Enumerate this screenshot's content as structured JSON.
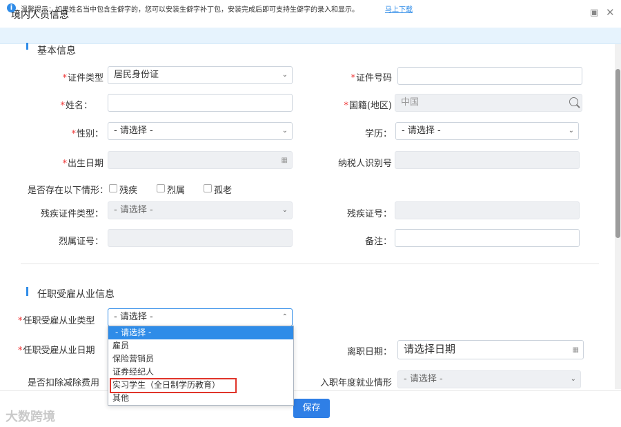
{
  "window": {
    "title": "境内人员信息"
  },
  "notice": {
    "text": "温馨提示：如果姓名当中包含生僻字的，您可以安装生僻字补丁包，安装完成后即可支持生僻字的录入和显示。",
    "link": "马上下载"
  },
  "basic": {
    "section_title": "基本信息",
    "id_type": {
      "label": "证件类型",
      "value": "居民身份证"
    },
    "id_number": {
      "label": "证件号码",
      "value": ""
    },
    "name": {
      "label": "姓名：",
      "value": ""
    },
    "nationality": {
      "label": "国籍(地区)",
      "value": "中国"
    },
    "gender": {
      "label": "性别：",
      "value": "- 请选择 -"
    },
    "education": {
      "label": "学历：",
      "value": "- 请选择 -"
    },
    "birth_date": {
      "label": "出生日期",
      "value": ""
    },
    "taxpayer_id": {
      "label": "纳税人识别号",
      "value": ""
    },
    "situations": {
      "label": "是否存在以下情形：",
      "options": [
        "残疾",
        "烈属",
        "孤老"
      ]
    },
    "disability_cert_type": {
      "label": "残疾证件类型：",
      "value": "- 请选择 -"
    },
    "disability_cert_no": {
      "label": "残疾证号：",
      "value": ""
    },
    "martyr_cert_no": {
      "label": "烈属证号：",
      "value": ""
    },
    "remark": {
      "label": "备注：",
      "value": ""
    }
  },
  "employment": {
    "section_title": "任职受雇从业信息",
    "type": {
      "label": "任职受雇从业类型",
      "value": "- 请选择 -"
    },
    "type_options": [
      "- 请选择 -",
      "雇员",
      "保险营销员",
      "证券经纪人",
      "实习学生（全日制学历教育）",
      "其他"
    ],
    "date": {
      "label": "任职受雇从业日期"
    },
    "leave_date": {
      "label": "离职日期：",
      "placeholder": "请选择日期"
    },
    "deduction": {
      "label": "是否扣除减除费用"
    },
    "entry_year_status": {
      "label": "入职年度就业情形",
      "value": "- 请选择 -"
    }
  },
  "footer": {
    "save_label": "保存"
  },
  "watermark": "大数跨境"
}
